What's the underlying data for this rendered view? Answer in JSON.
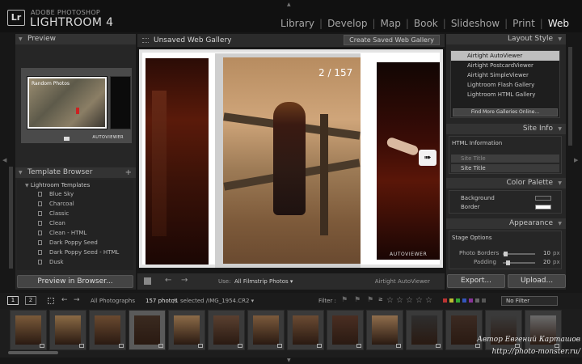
{
  "app": {
    "brand_sub": "ADOBE PHOTOSHOP",
    "brand_main": "LIGHTROOM 4",
    "logo": "Lr"
  },
  "modules": [
    "Library",
    "Develop",
    "Map",
    "Book",
    "Slideshow",
    "Print",
    "Web"
  ],
  "active_module": "Web",
  "left": {
    "preview_header": "Preview",
    "preview_title": "Random Photos",
    "preview_brand": "AUTOVIEWER",
    "template_header": "Template Browser",
    "template_folder": "Lightroom Templates",
    "templates": [
      "Blue Sky",
      "Charcoal",
      "Classic",
      "Clean",
      "Clean - HTML",
      "Dark Poppy Seed",
      "Dark Poppy Seed - HTML",
      "Dusk"
    ],
    "preview_button": "Preview in Browser..."
  },
  "center": {
    "title": "Unsaved Web Gallery",
    "create_button": "Create Saved Web Gallery",
    "counter": "2 / 157",
    "stage_brand": "AUTOVIEWER",
    "use_label": "Use:",
    "use_value": "All Filmstrip Photos ▾",
    "engine_label": "Airtight AutoViewer"
  },
  "right": {
    "layout_header": "Layout Style",
    "styles": [
      "Airtight AutoViewer",
      "Airtight PostcardViewer",
      "Airtight SimpleViewer",
      "Lightroom Flash Gallery",
      "Lightroom HTML Gallery"
    ],
    "selected_style": "Airtight AutoViewer",
    "find_button": "Find More Galleries Online...",
    "siteinfo_header": "Site Info",
    "html_info_label": "HTML Information",
    "site_title_placeholder": "Site Title",
    "site_title_value": "Site Title",
    "palette_header": "Color Palette",
    "background_label": "Background",
    "background_color": "#2a2a2a",
    "border_label": "Border",
    "border_color": "#ffffff",
    "appearance_header": "Appearance",
    "stage_options_label": "Stage Options",
    "photo_borders_label": "Photo Borders",
    "photo_borders_value": "10",
    "padding_label": "Padding",
    "padding_value": "20",
    "unit": "px",
    "export_button": "Export...",
    "upload_button": "Upload..."
  },
  "filmstrip": {
    "page1": "1",
    "page2": "2",
    "source": "All Photographs",
    "count": "157 photos",
    "selection": " /1 selected /IMG_1954.CR2 ▾",
    "filter_label": "Filter :",
    "filter_value": "No Filter",
    "thumb_count": 14,
    "watermark_line1": "Автор Евгений Карташов",
    "watermark_line2": "http://photo-monster.ru/"
  },
  "icons": {
    "logo": "lightroom-logo-icon",
    "collapse": "triangle-down-icon",
    "add": "plus-icon",
    "prev": "arrow-left-icon",
    "next": "arrow-right-icon",
    "grid": "grid-view-icon",
    "star": "star-icon"
  }
}
